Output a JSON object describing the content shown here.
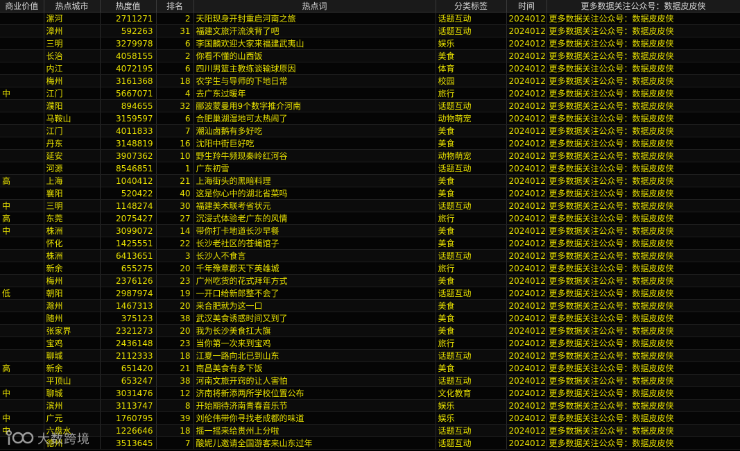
{
  "table": {
    "headers": [
      "商业价值",
      "热点城市",
      "热度值",
      "排名",
      "热点词",
      "分类标签",
      "时间",
      "更多数据关注公众号：数据皮皮侠"
    ],
    "rows": [
      [
        "",
        "漯河",
        "2711271",
        "2",
        "天阳现身开封重启河南之旅",
        "话题互动",
        "20240122",
        "更多数据关注公众号：数据皮皮侠"
      ],
      [
        "",
        "漳州",
        "592263",
        "31",
        "福建文旅汗流浃背了吧",
        "话题互动",
        "20240122",
        "更多数据关注公众号：数据皮皮侠"
      ],
      [
        "",
        "三明",
        "3279978",
        "6",
        "李国麟欢迎大家来福建武夷山",
        "娱乐",
        "20240122",
        "更多数据关注公众号：数据皮皮侠"
      ],
      [
        "",
        "长治",
        "4058155",
        "2",
        "你看不懂的山西饭",
        "美食",
        "20240122",
        "更多数据关注公众号：数据皮皮侠"
      ],
      [
        "",
        "内江",
        "4072195",
        "6",
        "四川男篮主教练谈输球原因",
        "体育",
        "20240122",
        "更多数据关注公众号：数据皮皮侠"
      ],
      [
        "",
        "梅州",
        "3161368",
        "18",
        "农学生与导师的下地日常",
        "校园",
        "20240122",
        "更多数据关注公众号：数据皮皮侠"
      ],
      [
        "中",
        "江门",
        "5667071",
        "4",
        "去广东过暖年",
        "旅行",
        "20240122",
        "更多数据关注公众号：数据皮皮侠"
      ],
      [
        "",
        "濮阳",
        "894655",
        "32",
        "郦波蒙曼用9个数字推介河南",
        "话题互动",
        "20240122",
        "更多数据关注公众号：数据皮皮侠"
      ],
      [
        "",
        "马鞍山",
        "3159597",
        "6",
        "合肥巢湖湿地可太热闹了",
        "动物萌宠",
        "20240122",
        "更多数据关注公众号：数据皮皮侠"
      ],
      [
        "",
        "江门",
        "4011833",
        "7",
        "潮汕卤鹅有多好吃",
        "美食",
        "20240122",
        "更多数据关注公众号：数据皮皮侠"
      ],
      [
        "",
        "丹东",
        "3148819",
        "16",
        "沈阳中街巨好吃",
        "美食",
        "20240122",
        "更多数据关注公众号：数据皮皮侠"
      ],
      [
        "",
        "延安",
        "3907362",
        "10",
        "野生羚牛频现秦岭红河谷",
        "动物萌宠",
        "20240122",
        "更多数据关注公众号：数据皮皮侠"
      ],
      [
        "",
        "河源",
        "8546851",
        "1",
        "广东初雪",
        "话题互动",
        "20240122",
        "更多数据关注公众号：数据皮皮侠"
      ],
      [
        "高",
        "上海",
        "1040412",
        "21",
        "上海街头的黑暗料理",
        "美食",
        "20240122",
        "更多数据关注公众号：数据皮皮侠"
      ],
      [
        "",
        "襄阳",
        "520422",
        "40",
        "这是你心中的湖北省菜吗",
        "美食",
        "20240122",
        "更多数据关注公众号：数据皮皮侠"
      ],
      [
        "中",
        "三明",
        "1148274",
        "30",
        "福建美术联考省状元",
        "话题互动",
        "20240122",
        "更多数据关注公众号：数据皮皮侠"
      ],
      [
        "高",
        "东莞",
        "2075427",
        "27",
        "沉浸式体验老广东的风情",
        "旅行",
        "20240122",
        "更多数据关注公众号：数据皮皮侠"
      ],
      [
        "中",
        "株洲",
        "3099072",
        "14",
        "带你打卡地道长沙早餐",
        "美食",
        "20240122",
        "更多数据关注公众号：数据皮皮侠"
      ],
      [
        "",
        "怀化",
        "1425551",
        "22",
        "长沙老社区的苍蝇馆子",
        "美食",
        "20240122",
        "更多数据关注公众号：数据皮皮侠"
      ],
      [
        "",
        "株洲",
        "6413651",
        "3",
        "长沙人不食言",
        "话题互动",
        "20240122",
        "更多数据关注公众号：数据皮皮侠"
      ],
      [
        "",
        "新余",
        "655275",
        "20",
        "千年豫章郡天下英雄城",
        "旅行",
        "20240122",
        "更多数据关注公众号：数据皮皮侠"
      ],
      [
        "",
        "梅州",
        "2376126",
        "23",
        "广州吃货的花式拜年方式",
        "美食",
        "20240122",
        "更多数据关注公众号：数据皮皮侠"
      ],
      [
        "低",
        "朝阳",
        "2987974",
        "19",
        "一开口给新郎整不会了",
        "话题互动",
        "20240122",
        "更多数据关注公众号：数据皮皮侠"
      ],
      [
        "",
        "滁州",
        "1467313",
        "20",
        "来合肥就为这一口",
        "美食",
        "20240122",
        "更多数据关注公众号：数据皮皮侠"
      ],
      [
        "",
        "随州",
        "375123",
        "38",
        "武汉美食诱惑时间又到了",
        "美食",
        "20240122",
        "更多数据关注公众号：数据皮皮侠"
      ],
      [
        "",
        "张家界",
        "2321273",
        "20",
        "我为长沙美食扛大旗",
        "美食",
        "20240122",
        "更多数据关注公众号：数据皮皮侠"
      ],
      [
        "",
        "宝鸡",
        "2436148",
        "23",
        "当你第一次来到宝鸡",
        "旅行",
        "20240122",
        "更多数据关注公众号：数据皮皮侠"
      ],
      [
        "",
        "聊城",
        "2112333",
        "18",
        "江夏一路向北已到山东",
        "话题互动",
        "20240122",
        "更多数据关注公众号：数据皮皮侠"
      ],
      [
        "高",
        "新余",
        "651420",
        "21",
        "南昌美食有多下饭",
        "美食",
        "20240122",
        "更多数据关注公众号：数据皮皮侠"
      ],
      [
        "",
        "平顶山",
        "653247",
        "38",
        "河南文旅开窍的让人害怕",
        "话题互动",
        "20240122",
        "更多数据关注公众号：数据皮皮侠"
      ],
      [
        "中",
        "聊城",
        "3031476",
        "12",
        "济南将新添两所学校位置公布",
        "文化教育",
        "20240122",
        "更多数据关注公众号：数据皮皮侠"
      ],
      [
        "",
        "滨州",
        "3113747",
        "8",
        "开始期待济南青春音乐节",
        "娱乐",
        "20240122",
        "更多数据关注公众号：数据皮皮侠"
      ],
      [
        "中",
        "广元",
        "1760795",
        "39",
        "刘伦伟带你寻找老成都的味道",
        "娱乐",
        "20240122",
        "更多数据关注公众号：数据皮皮侠"
      ],
      [
        "中",
        "六盘水",
        "1226646",
        "18",
        "摇一摇来给贵州上分啦",
        "话题互动",
        "20240122",
        "更多数据关注公众号：数据皮皮侠"
      ],
      [
        "",
        "德州",
        "3513645",
        "7",
        "酸妮儿邀请全国游客来山东过年",
        "话题互动",
        "20240122",
        "更多数据关注公众号：数据皮皮侠"
      ]
    ]
  },
  "watermark": {
    "text": "大数跨境"
  }
}
